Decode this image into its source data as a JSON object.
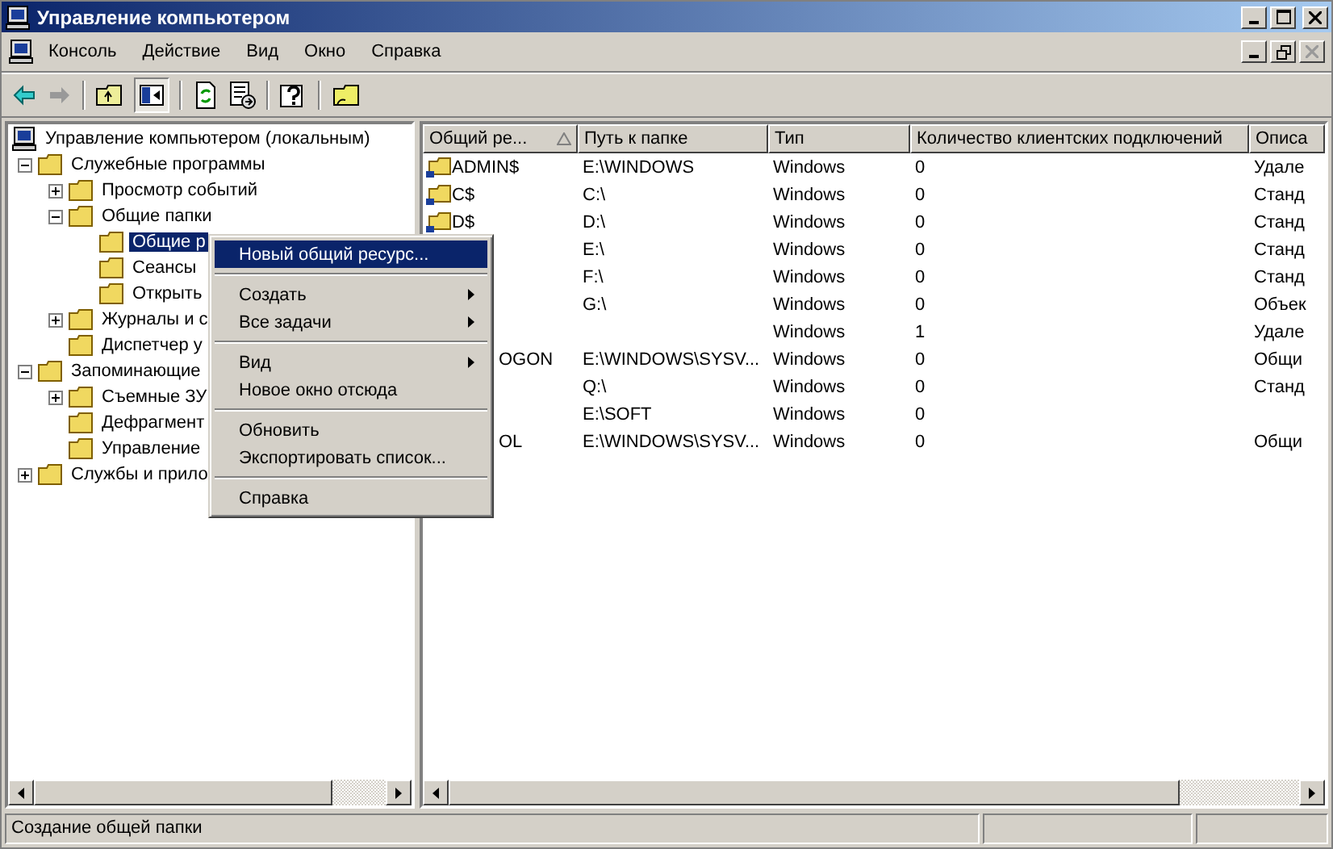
{
  "window": {
    "title": "Управление компьютером"
  },
  "menu_bar": [
    "Консоль",
    "Действие",
    "Вид",
    "Окно",
    "Справка"
  ],
  "tree": [
    {
      "label": "Управление компьютером (локальным)",
      "selected": false,
      "children": [
        {
          "label": "Служебные программы",
          "expanded": true,
          "selected": false,
          "children": [
            {
              "label": "Просмотр событий",
              "expanded": false,
              "selected": false
            },
            {
              "label": "Общие папки",
              "expanded": true,
              "selected": false,
              "children": [
                {
                  "label": "Общие р",
                  "selected": true
                },
                {
                  "label": "Сеансы",
                  "selected": false
                },
                {
                  "label": "Открыть",
                  "selected": false
                }
              ]
            },
            {
              "label": "Журналы и с",
              "expanded": false,
              "selected": false
            },
            {
              "label": "Диспетчер у",
              "selected": false
            }
          ]
        },
        {
          "label": "Запоминающие",
          "expanded": true,
          "selected": false,
          "children": [
            {
              "label": "Съемные ЗУ",
              "expanded": false,
              "selected": false
            },
            {
              "label": "Дефрагмент",
              "selected": false
            },
            {
              "label": "Управление",
              "selected": false
            }
          ]
        },
        {
          "label": "Службы и прило",
          "expanded": false,
          "selected": false
        }
      ]
    }
  ],
  "table": {
    "columns": [
      "Общий ре...",
      "Путь к папке",
      "Тип",
      "Количество клиентских подключений",
      "Описа"
    ],
    "rows": [
      {
        "icon": true,
        "name": "ADMIN$",
        "path": "E:\\WINDOWS",
        "type": "Windows",
        "clients": "0",
        "description": "Удале"
      },
      {
        "icon": true,
        "name": "C$",
        "path": "C:\\",
        "type": "Windows",
        "clients": "0",
        "description": "Станд"
      },
      {
        "icon": true,
        "name": "D$",
        "path": "D:\\",
        "type": "Windows",
        "clients": "0",
        "description": "Станд"
      },
      {
        "icon": false,
        "path": "E:\\",
        "type": "Windows",
        "clients": "0",
        "description": "Станд"
      },
      {
        "icon": false,
        "path": "F:\\",
        "type": "Windows",
        "clients": "0",
        "description": "Станд"
      },
      {
        "icon": false,
        "path": "G:\\",
        "type": "Windows",
        "clients": "0",
        "description": "Объек"
      },
      {
        "icon": false,
        "type": "Windows",
        "clients": "1",
        "description": "Удале"
      },
      {
        "icon": false,
        "name": "OGON",
        "path": "E:\\WINDOWS\\SYSV...",
        "type": "Windows",
        "clients": "0",
        "description": "Общи"
      },
      {
        "icon": false,
        "path": "Q:\\",
        "type": "Windows",
        "clients": "0",
        "description": "Станд"
      },
      {
        "icon": false,
        "path": "E:\\SOFT",
        "type": "Windows",
        "clients": "0"
      },
      {
        "icon": false,
        "name": "OL",
        "path": "E:\\WINDOWS\\SYSV...",
        "type": "Windows",
        "clients": "0",
        "description": "Общи"
      }
    ]
  },
  "context_menu": [
    {
      "kind": "item",
      "label": "Новый общий ресурс...",
      "selected": true
    },
    {
      "kind": "separator"
    },
    {
      "kind": "submenu",
      "label": "Создать",
      "selected": false
    },
    {
      "kind": "submenu",
      "label": "Все задачи",
      "selected": false
    },
    {
      "kind": "separator"
    },
    {
      "kind": "submenu",
      "label": "Вид",
      "selected": false
    },
    {
      "kind": "item",
      "label": "Новое окно отсюда",
      "selected": false
    },
    {
      "kind": "separator"
    },
    {
      "kind": "item",
      "label": "Обновить",
      "selected": false
    },
    {
      "kind": "item",
      "label": "Экспортировать список...",
      "selected": false
    },
    {
      "kind": "separator"
    },
    {
      "kind": "item",
      "label": "Справка",
      "selected": false
    }
  ],
  "status_bar": {
    "text": "Создание общей папки"
  }
}
